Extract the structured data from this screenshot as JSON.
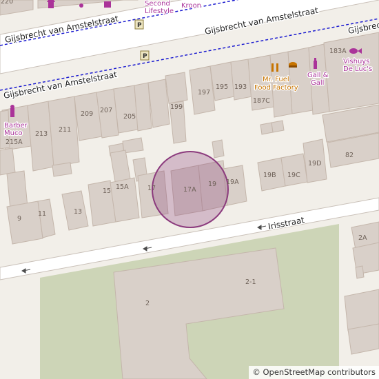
{
  "map": {
    "colors": {
      "background": "#f2efe9",
      "road": "#ffffff",
      "road_casing": "#bdb3aa",
      "building": "#d9d0c9",
      "park": "#cdd5b7",
      "rail": "#1a1ad0",
      "marker": "#8b3a7d",
      "poi_text": "#aa3399",
      "food_text": "#c77400"
    },
    "streets": [
      {
        "name": "Gijsbrecht van Amstelstraat"
      },
      {
        "name": "Gijsbrecht van Amstelstraat"
      },
      {
        "name": "Gijsbrecht van Amstelstraat"
      },
      {
        "name": "Gijsbrecht van Amstelstraat"
      },
      {
        "name": "Irisstraat"
      }
    ],
    "house_numbers": [
      "220",
      "213",
      "211",
      "209",
      "207",
      "205",
      "199",
      "197",
      "195",
      "193",
      "187C",
      "215A",
      "183A",
      "15",
      "15A",
      "17",
      "17A",
      "19",
      "19A",
      "19B",
      "19C",
      "19D",
      "13",
      "11",
      "9",
      "82",
      "2",
      "2-1",
      "2A"
    ],
    "pois": [
      {
        "label": "Second Lifestyle",
        "icon": "clothes-shop-icon"
      },
      {
        "label": "Kroon",
        "icon": "shop-icon"
      },
      {
        "label": "Mr. Fuel Food Factory",
        "icon": "fast-food-icon"
      },
      {
        "label": "Gall & Gall",
        "icon": "wine-shop-icon"
      },
      {
        "label": "Vishuys De Luc's",
        "icon": "fish-shop-icon"
      },
      {
        "label": "Barber Muco",
        "icon": "hairdresser-icon"
      }
    ],
    "marker": {
      "icon": "location-circle-icon",
      "label": "17A"
    },
    "parking_icon": "parking-icon",
    "attribution": "© OpenStreetMap contributors"
  }
}
